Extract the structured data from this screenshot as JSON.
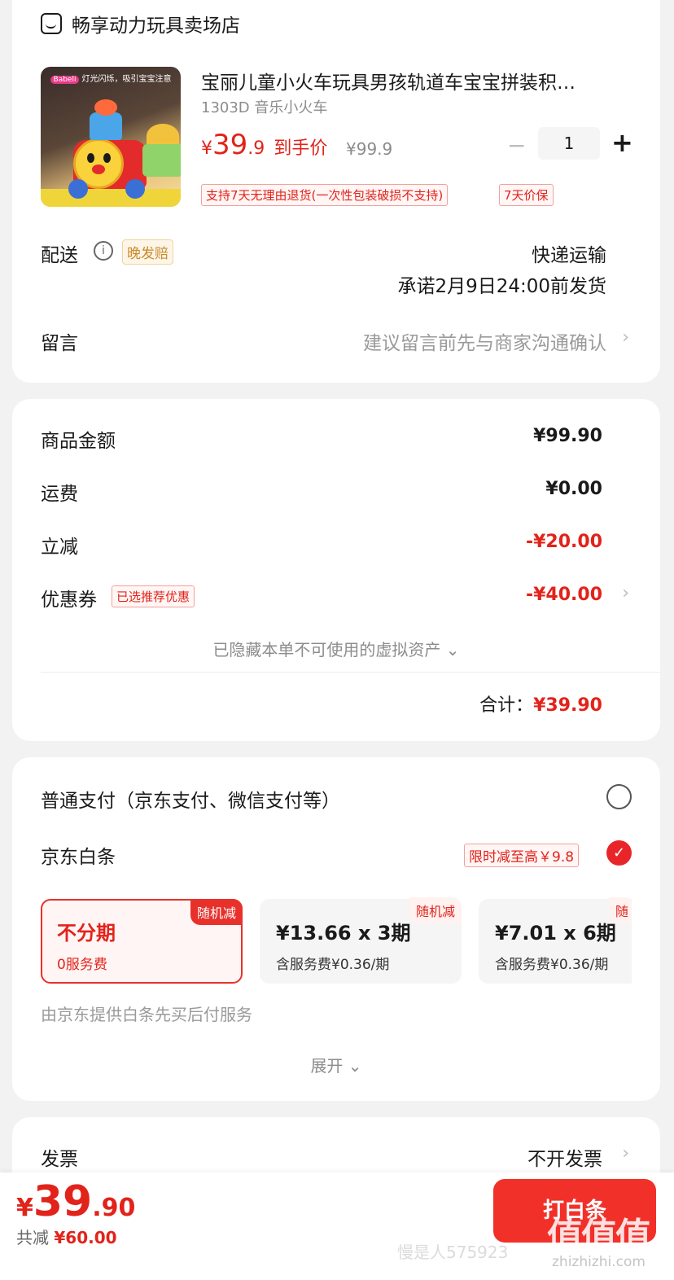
{
  "shop": {
    "icon": "shop-icon",
    "name": "畅享动力玩具卖场店"
  },
  "product": {
    "image_banner": "灯光闪烁，吸引宝宝注意",
    "title": "宝丽儿童小火车玩具男孩轨道车宝宝拼装积…",
    "sku": "1303D 音乐小火车",
    "price_currency": "¥",
    "price_int": "39",
    "price_dec": ".9",
    "price_label": "到手价",
    "original_price": "¥99.9",
    "quantity": "1",
    "minus_label": "−",
    "plus_label": "+",
    "tags": [
      "支持7天无理由退货(一次性包装破损不支持)",
      "7天价保"
    ]
  },
  "delivery": {
    "label": "配送",
    "info_icon": "info-icon",
    "late_tag": "晚发赔",
    "method": "快递运输",
    "promise": "承诺2月9日24:00前发货"
  },
  "message": {
    "label": "留言",
    "placeholder": "建议留言前先与商家沟通确认"
  },
  "summary": {
    "goods_label": "商品金额",
    "goods_value": "¥99.90",
    "shipping_label": "运费",
    "shipping_value": "¥0.00",
    "discount_label": "立减",
    "discount_value": "-¥20.00",
    "coupon_label": "优惠券",
    "coupon_tag": "已选推荐优惠",
    "coupon_value": "-¥40.00",
    "hidden_assets": "已隐藏本单不可使用的虚拟资产",
    "total_label": "合计：",
    "total_value": "¥39.90"
  },
  "payment": {
    "normal_label": "普通支付（京东支付、微信支付等）",
    "baitiao_label": "京东白条",
    "baitiao_promo": "限时减至高￥9.8",
    "plans": [
      {
        "badge": "随机减",
        "title": "不分期",
        "sub": "0服务费"
      },
      {
        "badge": "随机减",
        "title": "¥13.66 x 3期",
        "sub": "含服务费¥0.36/期"
      },
      {
        "badge": "随",
        "title": "¥7.01 x 6期",
        "sub": "含服务费¥0.36/期"
      }
    ],
    "provider_note": "由京东提供白条先买后付服务",
    "expand_label": "展开"
  },
  "invoice": {
    "label": "发票",
    "value": "不开发票"
  },
  "footer": {
    "price_currency": "¥",
    "price_int": "39",
    "price_dec": ".90",
    "saved_label": "共减",
    "saved_value": "¥60.00",
    "submit_label": "打白条"
  },
  "watermark": {
    "text": "值值值",
    "sub": "zhizhizhi.com",
    "user": "慢是人575923"
  },
  "colors": {
    "accent": "#e2231a",
    "button": "#f2302a"
  }
}
